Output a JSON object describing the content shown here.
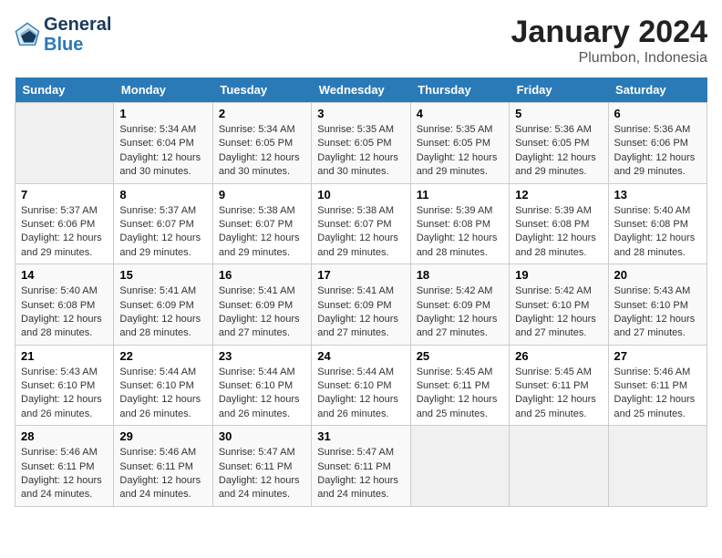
{
  "header": {
    "logo_text_general": "General",
    "logo_text_blue": "Blue",
    "title": "January 2024",
    "subtitle": "Plumbon, Indonesia"
  },
  "weekdays": [
    "Sunday",
    "Monday",
    "Tuesday",
    "Wednesday",
    "Thursday",
    "Friday",
    "Saturday"
  ],
  "weeks": [
    [
      {
        "day": "",
        "empty": true
      },
      {
        "day": "1",
        "sunrise": "5:34 AM",
        "sunset": "6:04 PM",
        "daylight": "12 hours and 30 minutes."
      },
      {
        "day": "2",
        "sunrise": "5:34 AM",
        "sunset": "6:05 PM",
        "daylight": "12 hours and 30 minutes."
      },
      {
        "day": "3",
        "sunrise": "5:35 AM",
        "sunset": "6:05 PM",
        "daylight": "12 hours and 30 minutes."
      },
      {
        "day": "4",
        "sunrise": "5:35 AM",
        "sunset": "6:05 PM",
        "daylight": "12 hours and 29 minutes."
      },
      {
        "day": "5",
        "sunrise": "5:36 AM",
        "sunset": "6:05 PM",
        "daylight": "12 hours and 29 minutes."
      },
      {
        "day": "6",
        "sunrise": "5:36 AM",
        "sunset": "6:06 PM",
        "daylight": "12 hours and 29 minutes."
      }
    ],
    [
      {
        "day": "7",
        "sunrise": "5:37 AM",
        "sunset": "6:06 PM",
        "daylight": "12 hours and 29 minutes."
      },
      {
        "day": "8",
        "sunrise": "5:37 AM",
        "sunset": "6:07 PM",
        "daylight": "12 hours and 29 minutes."
      },
      {
        "day": "9",
        "sunrise": "5:38 AM",
        "sunset": "6:07 PM",
        "daylight": "12 hours and 29 minutes."
      },
      {
        "day": "10",
        "sunrise": "5:38 AM",
        "sunset": "6:07 PM",
        "daylight": "12 hours and 29 minutes."
      },
      {
        "day": "11",
        "sunrise": "5:39 AM",
        "sunset": "6:08 PM",
        "daylight": "12 hours and 28 minutes."
      },
      {
        "day": "12",
        "sunrise": "5:39 AM",
        "sunset": "6:08 PM",
        "daylight": "12 hours and 28 minutes."
      },
      {
        "day": "13",
        "sunrise": "5:40 AM",
        "sunset": "6:08 PM",
        "daylight": "12 hours and 28 minutes."
      }
    ],
    [
      {
        "day": "14",
        "sunrise": "5:40 AM",
        "sunset": "6:08 PM",
        "daylight": "12 hours and 28 minutes."
      },
      {
        "day": "15",
        "sunrise": "5:41 AM",
        "sunset": "6:09 PM",
        "daylight": "12 hours and 28 minutes."
      },
      {
        "day": "16",
        "sunrise": "5:41 AM",
        "sunset": "6:09 PM",
        "daylight": "12 hours and 27 minutes."
      },
      {
        "day": "17",
        "sunrise": "5:41 AM",
        "sunset": "6:09 PM",
        "daylight": "12 hours and 27 minutes."
      },
      {
        "day": "18",
        "sunrise": "5:42 AM",
        "sunset": "6:09 PM",
        "daylight": "12 hours and 27 minutes."
      },
      {
        "day": "19",
        "sunrise": "5:42 AM",
        "sunset": "6:10 PM",
        "daylight": "12 hours and 27 minutes."
      },
      {
        "day": "20",
        "sunrise": "5:43 AM",
        "sunset": "6:10 PM",
        "daylight": "12 hours and 27 minutes."
      }
    ],
    [
      {
        "day": "21",
        "sunrise": "5:43 AM",
        "sunset": "6:10 PM",
        "daylight": "12 hours and 26 minutes."
      },
      {
        "day": "22",
        "sunrise": "5:44 AM",
        "sunset": "6:10 PM",
        "daylight": "12 hours and 26 minutes."
      },
      {
        "day": "23",
        "sunrise": "5:44 AM",
        "sunset": "6:10 PM",
        "daylight": "12 hours and 26 minutes."
      },
      {
        "day": "24",
        "sunrise": "5:44 AM",
        "sunset": "6:10 PM",
        "daylight": "12 hours and 26 minutes."
      },
      {
        "day": "25",
        "sunrise": "5:45 AM",
        "sunset": "6:11 PM",
        "daylight": "12 hours and 25 minutes."
      },
      {
        "day": "26",
        "sunrise": "5:45 AM",
        "sunset": "6:11 PM",
        "daylight": "12 hours and 25 minutes."
      },
      {
        "day": "27",
        "sunrise": "5:46 AM",
        "sunset": "6:11 PM",
        "daylight": "12 hours and 25 minutes."
      }
    ],
    [
      {
        "day": "28",
        "sunrise": "5:46 AM",
        "sunset": "6:11 PM",
        "daylight": "12 hours and 24 minutes."
      },
      {
        "day": "29",
        "sunrise": "5:46 AM",
        "sunset": "6:11 PM",
        "daylight": "12 hours and 24 minutes."
      },
      {
        "day": "30",
        "sunrise": "5:47 AM",
        "sunset": "6:11 PM",
        "daylight": "12 hours and 24 minutes."
      },
      {
        "day": "31",
        "sunrise": "5:47 AM",
        "sunset": "6:11 PM",
        "daylight": "12 hours and 24 minutes."
      },
      {
        "day": "",
        "empty": true
      },
      {
        "day": "",
        "empty": true
      },
      {
        "day": "",
        "empty": true
      }
    ]
  ]
}
